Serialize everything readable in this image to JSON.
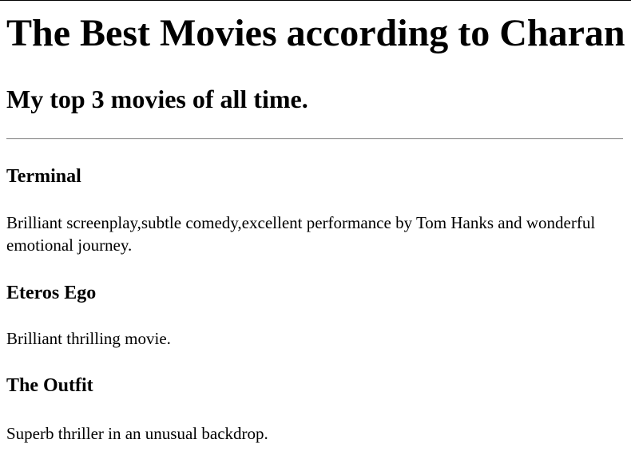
{
  "page": {
    "title": "The Best Movies according to Charan",
    "subtitle": "My top 3 movies of all time."
  },
  "movies": [
    {
      "title": "Terminal",
      "description": "Brilliant screenplay,subtle comedy,excellent performance by Tom Hanks and wonderful emotional journey."
    },
    {
      "title": "Eteros Ego",
      "description": "Brilliant thrilling movie."
    },
    {
      "title": "The Outfit",
      "description": "Superb thriller in an unusual backdrop."
    }
  ]
}
